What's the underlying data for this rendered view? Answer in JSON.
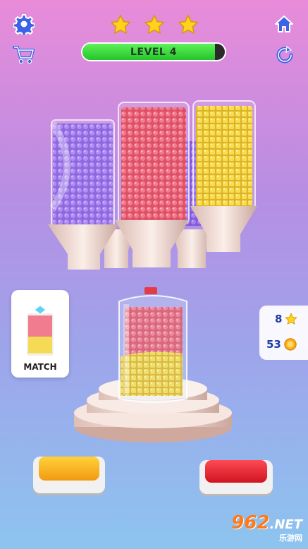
{
  "header": {
    "settings_icon": "gear-icon",
    "shop_icon": "cart-icon",
    "home_icon": "home-icon",
    "restart_icon": "restart-icon",
    "stars_earned": 3,
    "level_label": "LEVEL 4",
    "level_progress": 0.93
  },
  "match_card": {
    "label": "MATCH"
  },
  "counters": {
    "stars": "8",
    "coins": "53"
  },
  "dispensers": [
    {
      "color": "purple"
    },
    {
      "color": "red"
    },
    {
      "color": "yellow"
    }
  ],
  "colors": {
    "purple": "#8a5ee6",
    "red": "#ee4e63",
    "yellow": "#f3d12c",
    "button_yellow": "#f7b21a",
    "button_red": "#ee2a3d"
  },
  "watermark": {
    "brand": "962",
    "domain": ".NET",
    "sub": "乐游网"
  }
}
